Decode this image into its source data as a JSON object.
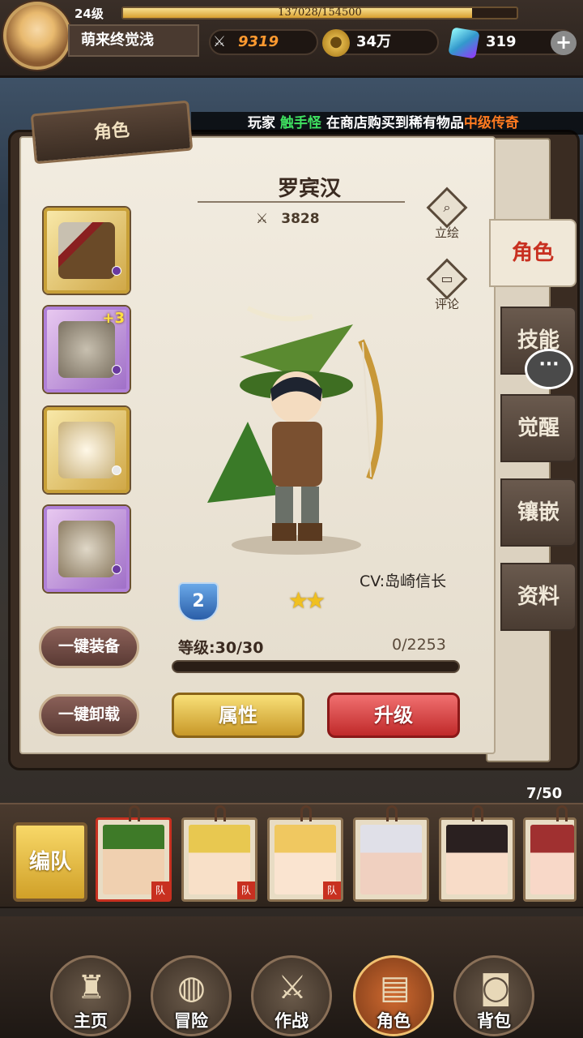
{
  "player": {
    "level": "24级",
    "exp": "137028/154500",
    "exp_fraction": 0.887,
    "name": "萌来终觉浅"
  },
  "resources": {
    "power": "9319",
    "gold": "34万",
    "gems": "319"
  },
  "ticker": {
    "prefix": "玩家",
    "player": "触手怪",
    "middle": "在商店购买到稀有物品",
    "item": "中级传奇"
  },
  "panel": {
    "title": "角色"
  },
  "character": {
    "name": "罗宾汉",
    "power": "3828",
    "cv": "CV:岛崎信长",
    "rank": "2",
    "stars": "★★",
    "level": "等级:30/30",
    "exp": "0/2253"
  },
  "side_buttons": {
    "portrait": "立绘",
    "comment": "评论"
  },
  "buttons": {
    "equip_all": "一键装备",
    "unequip_all": "一键卸载",
    "attributes": "属性",
    "upgrade": "升级"
  },
  "tabs": [
    "角色",
    "技能",
    "觉醒",
    "镶嵌",
    "资料"
  ],
  "equipment": [
    {
      "plus": ""
    },
    {
      "plus": "+3"
    },
    {
      "plus": ""
    },
    {
      "plus": ""
    }
  ],
  "team": {
    "button": "编队",
    "count": "7/50",
    "badge": "队"
  },
  "nav": [
    "主页",
    "冒险",
    "作战",
    "角色",
    "背包"
  ]
}
